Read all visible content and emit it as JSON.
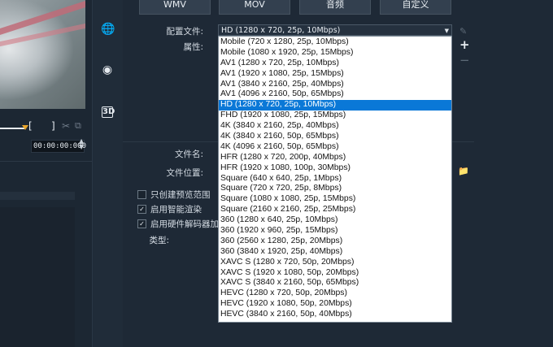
{
  "format_tabs": [
    "WMV",
    "MOV",
    "音频",
    "自定义"
  ],
  "labels": {
    "profile": "配置文件:",
    "properties": "属性:",
    "file_name": "文件名:",
    "file_location": "文件位置:",
    "type": "类型:"
  },
  "profile_select": {
    "value": "HD (1280 x 720, 25p, 10Mbps)",
    "arrow": "▼",
    "options": [
      "Mobile (720 x 1280, 25p, 10Mbps)",
      "Mobile (1080 x 1920, 25p, 15Mbps)",
      "AV1 (1280 x 720, 25p, 10Mbps)",
      "AV1 (1920 x 1080, 25p, 15Mbps)",
      "AV1 (3840 x 2160, 25p, 40Mbps)",
      "AV1 (4096 x 2160, 50p, 65Mbps)",
      "HD (1280 x 720, 25p, 10Mbps)",
      "FHD (1920 x 1080, 25p, 15Mbps)",
      "4K (3840 x 2160, 25p, 40Mbps)",
      "4K (3840 x 2160, 50p, 65Mbps)",
      "4K (4096 x 2160, 50p, 65Mbps)",
      "HFR (1280 x 720, 200p, 40Mbps)",
      "HFR (1920 x 1080, 100p, 30Mbps)",
      "Square (640 x 640, 25p, 1Mbps)",
      "Square (720 x 720, 25p, 8Mbps)",
      "Square (1080 x 1080, 25p, 15Mbps)",
      "Square (2160 x 2160, 25p, 25Mbps)",
      "360 (1280 x 640, 25p, 10Mbps)",
      "360 (1920 x 960, 25p, 15Mbps)",
      "360 (2560 x 1280, 25p, 20Mbps)",
      "360 (3840 x 1920, 25p, 40Mbps)",
      "XAVC S (1280 x 720, 50p, 20Mbps)",
      "XAVC S (1920 x 1080, 50p, 20Mbps)",
      "XAVC S (3840 x 2160, 50p, 65Mbps)",
      "HEVC (1280 x 720, 50p, 20Mbps)",
      "HEVC (1920 x 1080, 50p, 20Mbps)",
      "HEVC (3840 x 2160, 50p, 40Mbps)"
    ],
    "selected_index": 6
  },
  "checkboxes": [
    {
      "label": "只创建预览范围",
      "checked": false
    },
    {
      "label": "启用智能渲染",
      "checked": true
    },
    {
      "label": "启用硬件解码器加速",
      "checked": true
    }
  ],
  "preview": {
    "timecode": "00:00:00:000",
    "spin": "▲▼",
    "mark_in": "[",
    "mark_out": "]"
  },
  "icons": {
    "globe": "🌐",
    "disc": "◉",
    "three_d": "3D",
    "edit": "✎",
    "add": "+",
    "remove": "−",
    "folder": "📁",
    "scissors": "✂",
    "clip": "⧉"
  },
  "colors": {
    "selected_option": "#0a78d7",
    "background": "#1b2532",
    "accent_marker": "#e8a42a"
  }
}
